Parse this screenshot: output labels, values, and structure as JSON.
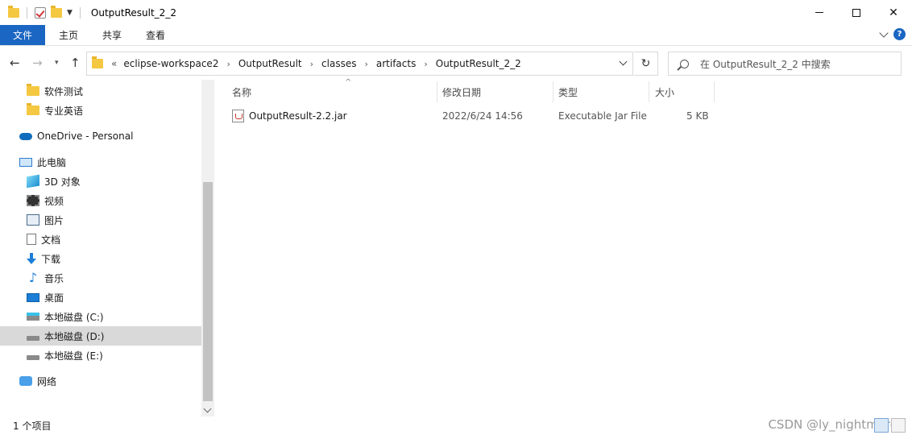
{
  "window": {
    "title": "OutputResult_2_2",
    "controls": {
      "minimize": "—",
      "maximize": "□",
      "close": "✕"
    }
  },
  "ribbon": {
    "tabs": [
      "文件",
      "主页",
      "共享",
      "查看"
    ],
    "help": "?"
  },
  "address": {
    "lead": "«",
    "crumbs": [
      "eclipse-workspace2",
      "OutputResult",
      "classes",
      "artifacts",
      "OutputResult_2_2"
    ],
    "separator": "›",
    "refresh": "↻"
  },
  "search": {
    "placeholder": "在 OutputResult_2_2 中搜索"
  },
  "nav": {
    "items": [
      {
        "label": "软件测试",
        "icon": "folder-icon"
      },
      {
        "label": "专业英语",
        "icon": "folder-icon"
      },
      {
        "label": "OneDrive - Personal",
        "icon": "onedrive-cloud-icon"
      },
      {
        "label": "此电脑",
        "icon": "this-pc-icon"
      },
      {
        "label": "3D 对象",
        "icon": "3d-objects-icon"
      },
      {
        "label": "视频",
        "icon": "videos-icon"
      },
      {
        "label": "图片",
        "icon": "pictures-icon"
      },
      {
        "label": "文档",
        "icon": "documents-icon"
      },
      {
        "label": "下载",
        "icon": "downloads-icon"
      },
      {
        "label": "音乐",
        "icon": "music-icon"
      },
      {
        "label": "桌面",
        "icon": "desktop-icon"
      },
      {
        "label": "本地磁盘 (C:)",
        "icon": "drive-c-icon"
      },
      {
        "label": "本地磁盘 (D:)",
        "icon": "drive-icon",
        "selected": true
      },
      {
        "label": "本地磁盘 (E:)",
        "icon": "drive-icon"
      },
      {
        "label": "网络",
        "icon": "network-icon"
      }
    ]
  },
  "columns": {
    "name": "名称",
    "modified": "修改日期",
    "type": "类型",
    "size": "大小"
  },
  "files": [
    {
      "name": "OutputResult-2.2.jar",
      "modified": "2022/6/24 14:56",
      "type": "Executable Jar File",
      "size": "5 KB",
      "icon": "jar-file-icon"
    }
  ],
  "status": {
    "item_count": "1 个项目"
  },
  "watermark": "CSDN @ly_nightmare"
}
